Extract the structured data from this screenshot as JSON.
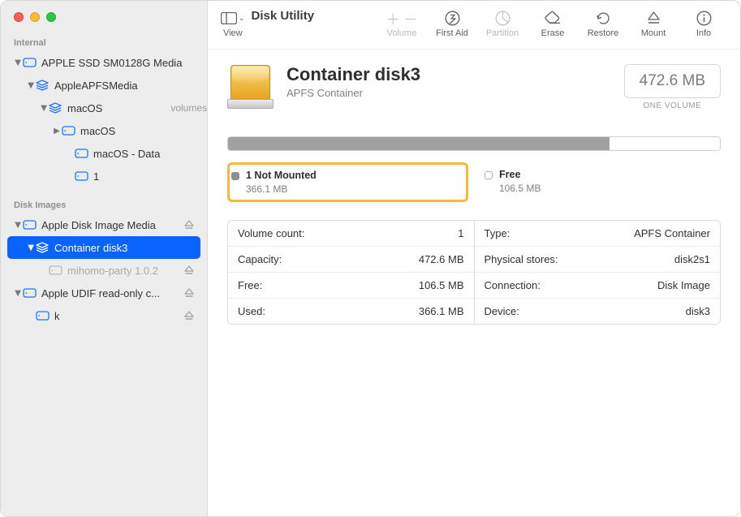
{
  "app_title": "Disk Utility",
  "toolbar": {
    "view": "View",
    "volume": "Volume",
    "first_aid": "First Aid",
    "partition": "Partition",
    "erase": "Erase",
    "restore": "Restore",
    "mount": "Mount",
    "info": "Info"
  },
  "sidebar": {
    "sections": {
      "internal": "Internal",
      "disk_images": "Disk Images"
    },
    "internal": [
      {
        "label": "APPLE SSD SM0128G Media",
        "indent": 0,
        "chev": "open",
        "icon": "disk"
      },
      {
        "label": "AppleAPFSMedia",
        "indent": 1,
        "chev": "open",
        "icon": "stack"
      },
      {
        "label": "macOS",
        "suffix": "volumes",
        "indent": 2,
        "chev": "open",
        "icon": "stack"
      },
      {
        "label": "macOS",
        "indent": 3,
        "chev": "closed",
        "icon": "disk"
      },
      {
        "label": "macOS - Data",
        "indent": 4,
        "chev": "none",
        "icon": "disk"
      },
      {
        "label": "1",
        "indent": 4,
        "chev": "none",
        "icon": "disk"
      }
    ],
    "disk_images": [
      {
        "label": "Apple Disk Image Media",
        "indent": 0,
        "chev": "open",
        "icon": "disk",
        "eject": true
      },
      {
        "label": "Container disk3",
        "indent": 1,
        "chev": "open",
        "icon": "stack",
        "selected": true
      },
      {
        "label": "mihomo-party 1.0.2",
        "indent": 2,
        "chev": "none",
        "icon": "disk",
        "dim": true,
        "eject": true
      },
      {
        "label": "Apple UDIF read-only c...",
        "indent": 0,
        "chev": "open",
        "icon": "disk",
        "eject": true
      },
      {
        "label": "k",
        "indent": 1,
        "chev": "none",
        "icon": "disk",
        "eject": true
      }
    ]
  },
  "header": {
    "title": "Container disk3",
    "subtitle": "APFS Container",
    "size": "472.6 MB",
    "size_caption": "ONE VOLUME"
  },
  "usage": {
    "used_pct": 77.5
  },
  "legend": [
    {
      "title": "1 Not Mounted",
      "value": "366.1 MB",
      "swatch": "dark",
      "highlight": true
    },
    {
      "title": "Free",
      "value": "106.5 MB",
      "swatch": "light",
      "highlight": false
    }
  ],
  "properties": {
    "left": [
      {
        "k": "Volume count:",
        "v": "1"
      },
      {
        "k": "Capacity:",
        "v": "472.6 MB"
      },
      {
        "k": "Free:",
        "v": "106.5 MB"
      },
      {
        "k": "Used:",
        "v": "366.1 MB"
      }
    ],
    "right": [
      {
        "k": "Type:",
        "v": "APFS Container"
      },
      {
        "k": "Physical stores:",
        "v": "disk2s1"
      },
      {
        "k": "Connection:",
        "v": "Disk Image"
      },
      {
        "k": "Device:",
        "v": "disk3"
      }
    ]
  }
}
